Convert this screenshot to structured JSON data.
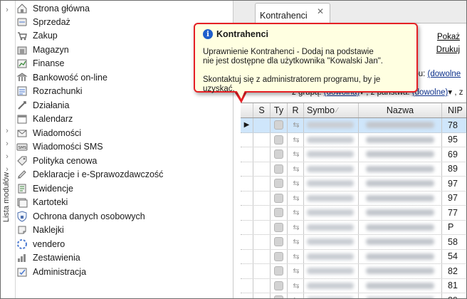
{
  "sidebar_strip": {
    "label": "Lista modułów"
  },
  "modules": [
    {
      "label": "Strona główna",
      "icon": "home-icon"
    },
    {
      "label": "Sprzedaż",
      "icon": "sales-icon"
    },
    {
      "label": "Zakup",
      "icon": "purchase-icon"
    },
    {
      "label": "Magazyn",
      "icon": "warehouse-icon"
    },
    {
      "label": "Finanse",
      "icon": "finance-icon"
    },
    {
      "label": "Bankowość on-line",
      "icon": "bank-icon"
    },
    {
      "label": "Rozrachunki",
      "icon": "settlements-icon"
    },
    {
      "label": "Działania",
      "icon": "actions-icon"
    },
    {
      "label": "Kalendarz",
      "icon": "calendar-icon"
    },
    {
      "label": "Wiadomości",
      "icon": "envelope-icon"
    },
    {
      "label": "Wiadomości SMS",
      "icon": "sms-icon"
    },
    {
      "label": "Polityka cenowa",
      "icon": "pricing-icon"
    },
    {
      "label": "Deklaracje i e-Sprawozdawczość",
      "icon": "declarations-icon"
    },
    {
      "label": "Ewidencje",
      "icon": "registers-icon"
    },
    {
      "label": "Kartoteki",
      "icon": "cards-icon"
    },
    {
      "label": "Ochrona danych osobowych",
      "icon": "shield-icon"
    },
    {
      "label": "Naklejki",
      "icon": "stickers-icon"
    },
    {
      "label": "vendero",
      "icon": "vendero-icon"
    },
    {
      "label": "Zestawienia",
      "icon": "reports-icon"
    },
    {
      "label": "Administracja",
      "icon": "admin-icon"
    }
  ],
  "tab": {
    "label": "Kontrahenci",
    "close": "✕"
  },
  "links": {
    "show": "Pokaż",
    "print": "Drukuj"
  },
  "filters": {
    "type_label": ", typu:",
    "type_value": "(dowolne",
    "group_label": "z grupą:",
    "group_value": "(dowolna)",
    "country_label": ", z państwa:",
    "country_value": "(dowolne)",
    "more_label": ", z"
  },
  "tooltip": {
    "title": "Kontrahenci",
    "line1": "Uprawnienie Kontrahenci - Dodaj na podstawie",
    "line2": "nie jest dostępne dla użytkownika \"Kowalski Jan\".",
    "line3": "Skontaktuj się z administratorem programu, by je uzyskać."
  },
  "grid": {
    "columns": {
      "s": "S",
      "ty": "Ty",
      "r": "R",
      "symbol": "Symbo",
      "name": "Nazwa",
      "nip": "NIP"
    },
    "rows": [
      {
        "nip": "78"
      },
      {
        "nip": "95"
      },
      {
        "nip": "69"
      },
      {
        "nip": "89"
      },
      {
        "nip": "97"
      },
      {
        "nip": "97"
      },
      {
        "nip": "77"
      },
      {
        "nip": "P"
      },
      {
        "nip": "58"
      },
      {
        "nip": "54"
      },
      {
        "nip": "82"
      },
      {
        "nip": "81"
      },
      {
        "nip": "89"
      }
    ]
  },
  "colors": {
    "tooltip_border": "#e52025",
    "tooltip_bg": "#ffffe1",
    "selection": "#cfe6fb"
  }
}
